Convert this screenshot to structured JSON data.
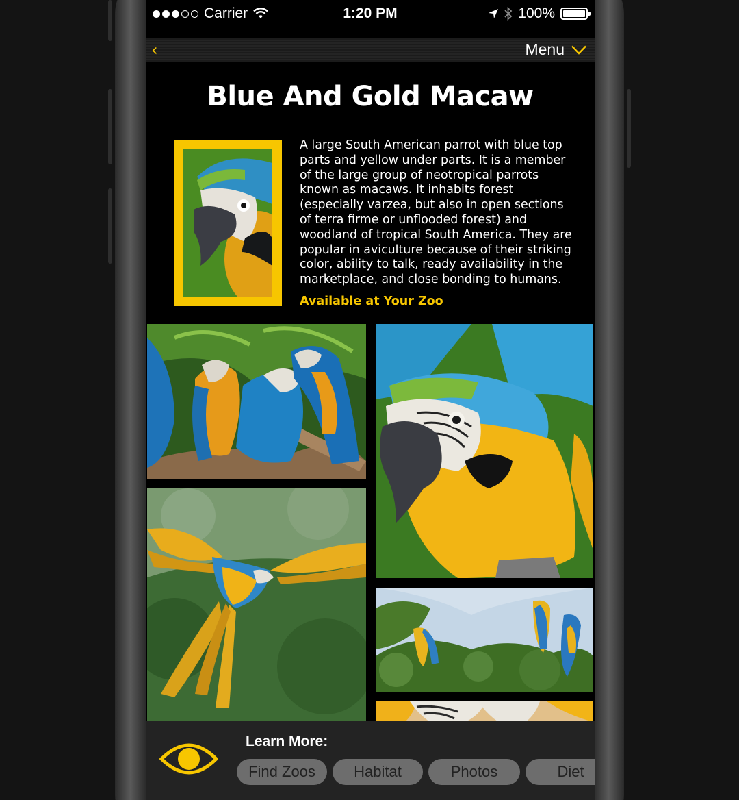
{
  "status_bar": {
    "carrier": "Carrier",
    "time": "1:20 PM",
    "battery": "100%",
    "signal_bars": 3
  },
  "nav": {
    "back_icon": "chevron-left-icon",
    "menu_label": "Menu",
    "menu_icon": "chevron-down-icon"
  },
  "animal": {
    "name": "Blue And Gold Macaw",
    "description": "A large South American parrot with blue top parts and yellow under parts. It is a member of the large group of neotropical parrots known as macaws. It inhabits forest (especially varzea, but also in open sections of terra firme or unflooded forest) and woodland of tropical South America. They are popular in aviculture because of their striking color, ability to talk, ready availability in the marketplace, and close bonding to humans.",
    "availability": "Available at Your Zoo"
  },
  "learn_more": {
    "title": "Learn More:",
    "icon": "eye-icon",
    "buttons": [
      "Find Zoos",
      "Habitat",
      "Photos",
      "Diet"
    ]
  },
  "colors": {
    "accent": "#f7c600",
    "background": "#000000",
    "pill": "#6d6d6d",
    "bottom_bar": "#232323"
  }
}
